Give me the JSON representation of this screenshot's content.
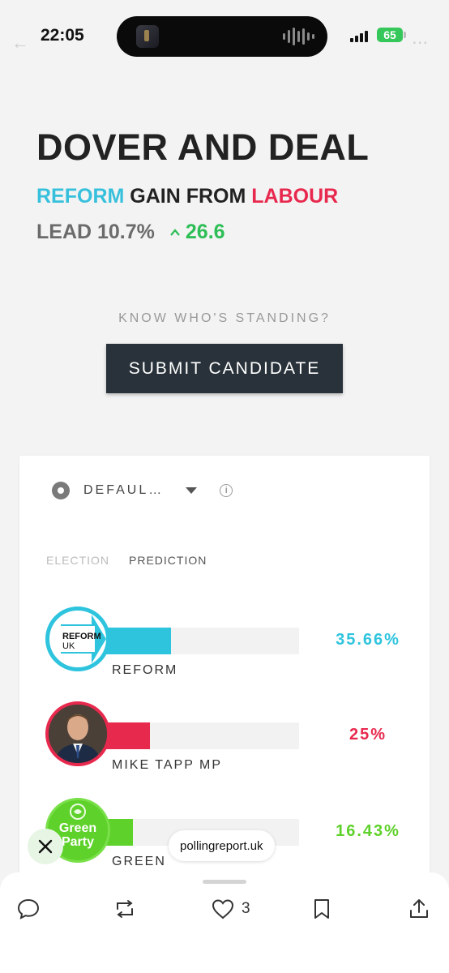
{
  "status_bar": {
    "time": "22:05",
    "battery": "65"
  },
  "header": {
    "constituency": "DOVER AND DEAL",
    "winner": "REFORM",
    "gain_text": "GAIN FROM",
    "loser": "LABOUR",
    "lead_label": "LEAD 10.7%",
    "lead_change": "26.6"
  },
  "cta": {
    "prompt": "KNOW WHO'S STANDING?",
    "button": "SUBMIT CANDIDATE"
  },
  "card": {
    "selector": "DEFAUL…",
    "tabs": [
      "ELECTION",
      "PREDICTION"
    ],
    "candidates": [
      {
        "name": "REFORM",
        "percent_label": "35.66%",
        "share": 35.66,
        "color": "#2ec4de",
        "logo_text": [
          "REFORM",
          "UK"
        ]
      },
      {
        "name": "MIKE TAPP MP",
        "percent_label": "25%",
        "share": 25,
        "color": "#e8294e"
      },
      {
        "name": "GREEN",
        "percent_label": "16.43%",
        "share": 16.43,
        "color": "#5ed12a",
        "logo_text": [
          "Green",
          "Party"
        ]
      }
    ]
  },
  "overlay": {
    "link": "pollingreport.uk",
    "close_icon": "close-icon"
  },
  "actions": {
    "like_count": "3"
  },
  "colors": {
    "reform": "#37c0dc",
    "labour": "#e8294e",
    "green": "#2dbe55",
    "button": "#29323a"
  }
}
